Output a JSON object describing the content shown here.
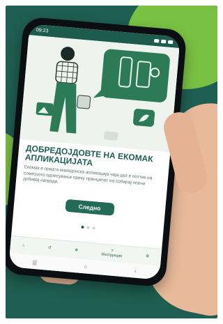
{
  "status_bar": {
    "time": "09:23"
  },
  "onboarding": {
    "title": "ДОБРЕДОЈДОВТЕ НА ЕКОМАК АПЛИКАЦИЈАТА",
    "body": "Екомак е првата македонска апликација чија цел е поттик на совесното однесување преку принципот на собирај поени добивај награди.",
    "cta_label": "Следно",
    "page_indicator": {
      "count": 3,
      "active": 1
    }
  },
  "tab_bar": {
    "tabs": [
      {
        "icon": "home-icon",
        "label": ""
      },
      {
        "icon": "history-icon",
        "label": ""
      },
      {
        "icon": "add-icon",
        "label": ""
      },
      {
        "icon": "help-icon",
        "label": "Инструкции"
      },
      {
        "icon": "gear-icon",
        "label": ""
      }
    ]
  },
  "android_nav": {
    "icons": [
      "recent-apps-icon",
      "home-circle-icon",
      "back-icon"
    ]
  },
  "colors": {
    "background": "#1f5e52",
    "accent_green": "#79c143",
    "primary_dark": "#236a57"
  }
}
